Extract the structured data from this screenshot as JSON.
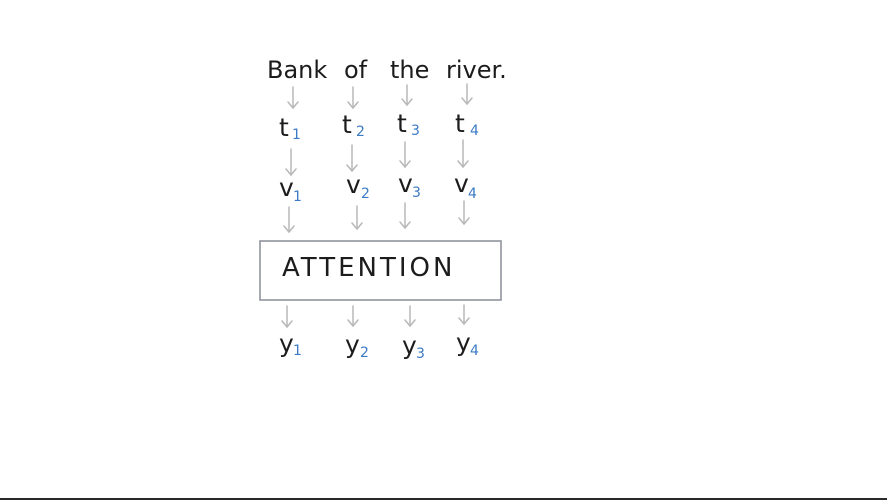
{
  "sentence": {
    "words": [
      "Bank",
      "of",
      "the",
      "river."
    ]
  },
  "rows": {
    "t": {
      "base": "t",
      "subs": [
        "1",
        "2",
        "3",
        "4"
      ]
    },
    "v": {
      "base": "v",
      "subs": [
        "1",
        "2",
        "3",
        "4"
      ]
    },
    "y": {
      "base": "y",
      "subs": [
        "1",
        "2",
        "3",
        "4"
      ]
    }
  },
  "attention": {
    "label": "ATTENTION"
  },
  "colors": {
    "ink": "#1c1c1c",
    "subscript": "#3b7ac4",
    "arrow": "#b8b8b8",
    "box_border": "#8f949c"
  }
}
